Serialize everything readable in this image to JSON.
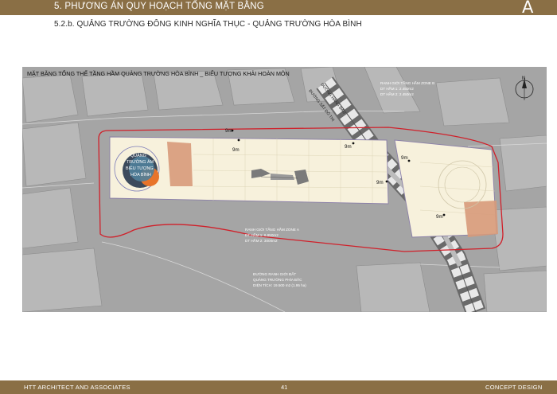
{
  "header": {
    "section_title": "5. PHƯƠNG ÁN QUY HOẠCH TỔNG MẶT BẰNG",
    "logo_letter": "A",
    "subsection_title": "5.2.b. QUẢNG TRƯỜNG ĐÔNG KINH NGHĨA THỤC - QUẢNG TRƯỜNG HÒA BÌNH"
  },
  "plan": {
    "title": "MẶT BẰNG TỔNG THỂ TẦNG HẦM QUẢNG TRƯỜNG HÒA BÌNH _ BIỂU TƯỢNG KHẢI HOÀN MÔN",
    "symbol_label": [
      "QUẢNG",
      "TRƯỜNG ÂM",
      "BIỂU TƯỢNG",
      "HÒA BÌNH"
    ],
    "road_label": "ĐƯỜNG HÀNG ĐẬU",
    "road_label_2": "ĐƯỜNG SẮT ĐÔ THỊ",
    "compass_label": "N",
    "dimensions": [
      "9m",
      "9m",
      "9m",
      "9m",
      "9m",
      "9m"
    ],
    "note_zone_b": [
      "RANH GIỚI TẦNG HẦM ZONE B",
      "DT HẦM 1: 2.450m2",
      "DT HẦM 2: 2.450m2"
    ],
    "note_zone_a": [
      "RANH GIỚI TẦNG HẦM ZONE A",
      "DT HẦM 1: 6.950m2",
      "DT HẦM 2: 3000m2"
    ],
    "note_boundary": [
      "ĐƯỜNG RANH GIỚI ĐẤT",
      "QUẢNG TRƯỜNG PHÍA BẮC",
      "DIỆN TÍCH: 19.500 m2 (1.95 ha)"
    ]
  },
  "footer": {
    "company": "HTT ARCHITECT AND ASSOCIATES",
    "page_number": "41",
    "phase": "CONCEPT DESIGN"
  },
  "colors": {
    "brand": "#8a6f45",
    "map_background": "#a5a5a5",
    "boundary_red": "#d0202a",
    "basement_fill": "#f7f1dc",
    "terracotta": "#d79a7a"
  }
}
